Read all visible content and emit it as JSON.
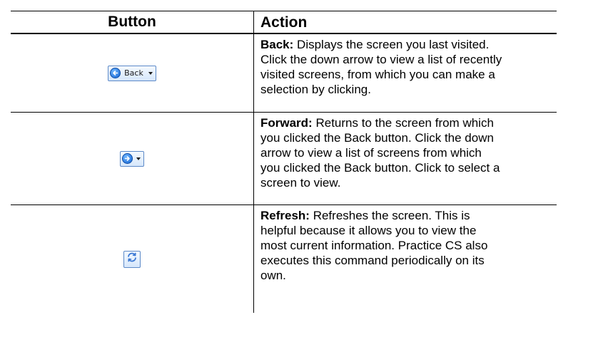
{
  "header": {
    "button_col": "Button",
    "action_col": "Action"
  },
  "rows": [
    {
      "button_text": "Back",
      "icon": "back-arrow-icon",
      "label": "Back:",
      "lines": [
        "Displays the screen you last visited.",
        "Click the down arrow to view a list of recently",
        "visited screens, from which you can make a",
        "selection by clicking."
      ]
    },
    {
      "icon": "forward-arrow-icon",
      "label": "Forward:",
      "lines": [
        "Returns to the screen from which",
        "you clicked the Back button. Click the down",
        "arrow to view a list of screens from which",
        "you clicked the Back button. Click to select a",
        "screen to view."
      ]
    },
    {
      "icon": "refresh-icon",
      "label": "Refresh:",
      "lines": [
        "Refreshes the screen. This is",
        "helpful because it allows you to view the",
        "most current information. Practice CS also",
        "executes this command periodically on its",
        "own."
      ]
    }
  ]
}
